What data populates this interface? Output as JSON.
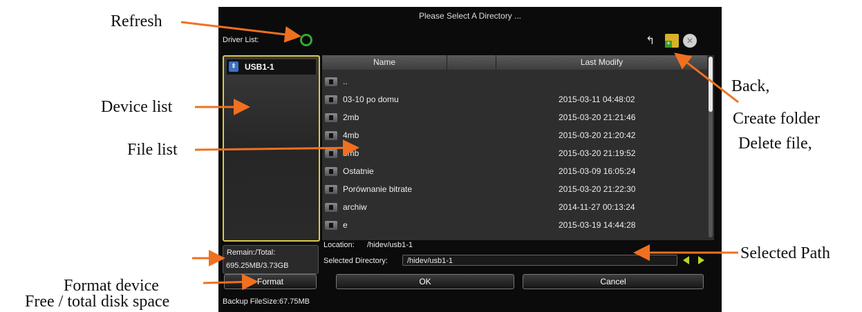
{
  "annotations": {
    "refresh": "Refresh",
    "device_list": "Device list",
    "file_list": "File list",
    "back": "Back,",
    "create_folder": "Create folder",
    "delete_file": "Delete file,",
    "selected_path": "Selected Path",
    "format_device": "Format device",
    "free_total": "Free / total disk space"
  },
  "dialog": {
    "title": "Please Select A Directory ...",
    "driver_list_label": "Driver List:",
    "devices": [
      {
        "label": "USB1-1",
        "icon": "usb-icon"
      }
    ],
    "columns": {
      "name": "Name",
      "last_modify": "Last Modify"
    },
    "files": [
      {
        "name": "..",
        "date": ""
      },
      {
        "name": "03-10 po domu",
        "date": "2015-03-11 04:48:02"
      },
      {
        "name": "2mb",
        "date": "2015-03-20 21:21:46"
      },
      {
        "name": "4mb",
        "date": "2015-03-20 21:20:42"
      },
      {
        "name": "6mb",
        "date": "2015-03-20 21:19:52"
      },
      {
        "name": "Ostatnie",
        "date": "2015-03-09 16:05:24"
      },
      {
        "name": "Porównanie bitrate",
        "date": "2015-03-20 21:22:30"
      },
      {
        "name": "archiw",
        "date": "2014-11-27 00:13:24"
      },
      {
        "name": "e",
        "date": "2015-03-19 14:44:28"
      }
    ],
    "remain_label": "Remain:/Total:",
    "remain_value": "695.25MB/3.73GB",
    "location_label": "Location:",
    "location_value": "/hidev/usb1-1",
    "selected_dir_label": "Selected Directory:",
    "selected_dir_value": "/hidev/usb1-1",
    "format_button": "Format",
    "ok_button": "OK",
    "cancel_button": "Cancel",
    "backup_filesize": "Backup FileSize:67.75MB"
  },
  "colors": {
    "arrow": "#f07020",
    "accent": "#d9c84a",
    "refresh": "#33aa33"
  }
}
